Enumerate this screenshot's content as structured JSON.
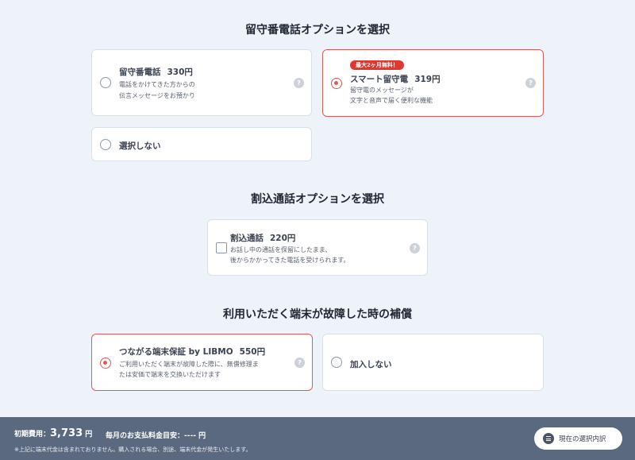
{
  "sections": {
    "voicemail_title": "留守番電話オプションを選択",
    "callwaiting_title": "割込通話オプションを選択",
    "protection_title": "利用いただく端末が故障した時の補償"
  },
  "voicemail": {
    "opt1": {
      "name": "留守番電話",
      "price": "330円",
      "desc1": "電話をかけてきた方からの",
      "desc2": "伝言メッセージをお預かり",
      "selected": false
    },
    "opt2": {
      "badge": "最大2ヶ月無料！",
      "name": "スマート留守電",
      "price": "319円",
      "desc1": "留守電のメッセージが",
      "desc2": "文字と音声で届く便利な機能",
      "selected": true
    },
    "none": {
      "label": "選択しない",
      "selected": false
    }
  },
  "callwaiting": {
    "opt1": {
      "name": "割込通話",
      "price": "220円",
      "desc1": "お話し中の通話を保留にしたまま、",
      "desc2": "後からかかってきた電話を受けられます。",
      "checked": false
    }
  },
  "protection": {
    "opt1": {
      "name": "つながる端末保証 by LIBMO",
      "price": "550円",
      "desc1": "ご利用いただく端末が故障した際に、無償修理ま",
      "desc2": "たは安価で端末を交換いただけます",
      "selected": true
    },
    "none": {
      "label": "加入しない",
      "selected": false
    }
  },
  "help_symbol": "?",
  "footer": {
    "initial_label": "初期費用：",
    "initial_value": "3,733",
    "initial_unit": "円",
    "monthly_label": "毎月のお支払料金目安：",
    "monthly_value": "----",
    "monthly_unit": "円",
    "note": "※上記に端末代金は含まれておりません。購入される場合、別途、端末代金が発生いたします。",
    "current_selection_button": "現在の選択内訳"
  },
  "colors": {
    "accent": "#e05a5a",
    "badge": "#e0382e",
    "footer_bg": "#5b6980",
    "page_bg": "#eef3f9"
  }
}
